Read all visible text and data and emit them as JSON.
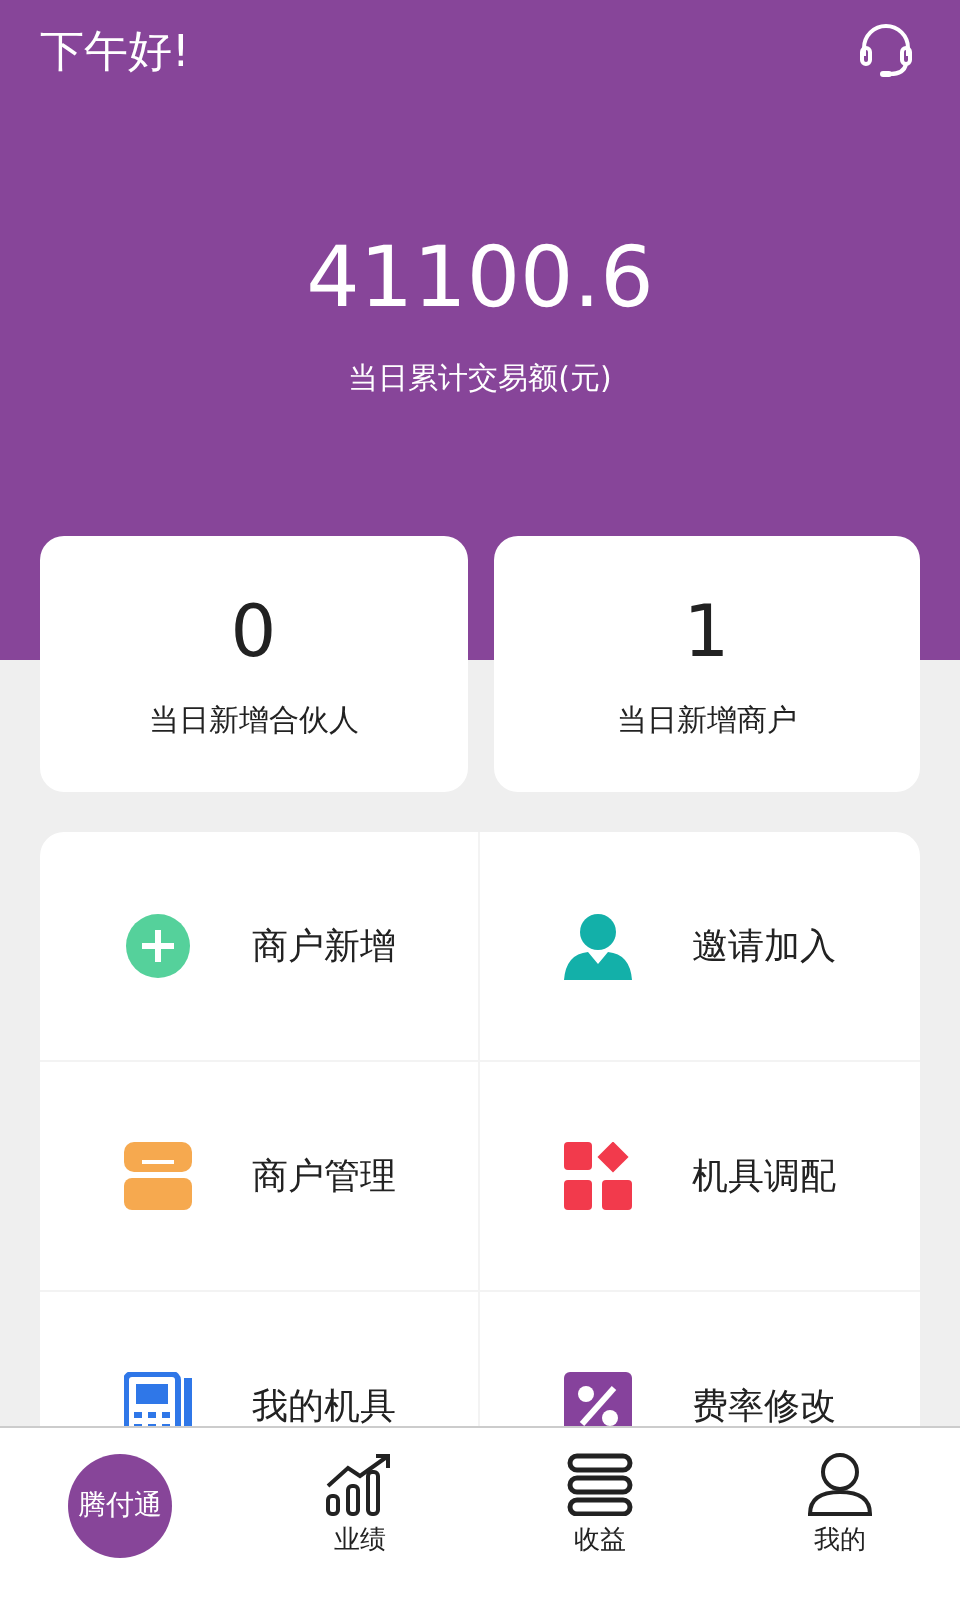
{
  "header": {
    "greeting": "下午好!",
    "amount": "41100.6",
    "amount_label": "当日累计交易额(元)"
  },
  "stats": [
    {
      "value": "0",
      "label": "当日新增合伙人"
    },
    {
      "value": "1",
      "label": "当日新增商户"
    }
  ],
  "menu": [
    {
      "kind": "plus",
      "label": "商户新增",
      "color": "#55d19b"
    },
    {
      "kind": "person",
      "label": "邀请加入",
      "color": "#13b0a9"
    },
    {
      "kind": "shop",
      "label": "商户管理",
      "color": "#f6a94f"
    },
    {
      "kind": "apps",
      "label": "机具调配",
      "color": "#f23a4c"
    },
    {
      "kind": "terminal",
      "label": "我的机具",
      "color": "#2f77e8"
    },
    {
      "kind": "percent",
      "label": "费率修改",
      "color": "#86429c"
    }
  ],
  "nav": [
    {
      "kind": "logo",
      "label": "腾付通"
    },
    {
      "kind": "chart",
      "label": "业绩"
    },
    {
      "kind": "list",
      "label": "收益"
    },
    {
      "kind": "user",
      "label": "我的"
    }
  ]
}
